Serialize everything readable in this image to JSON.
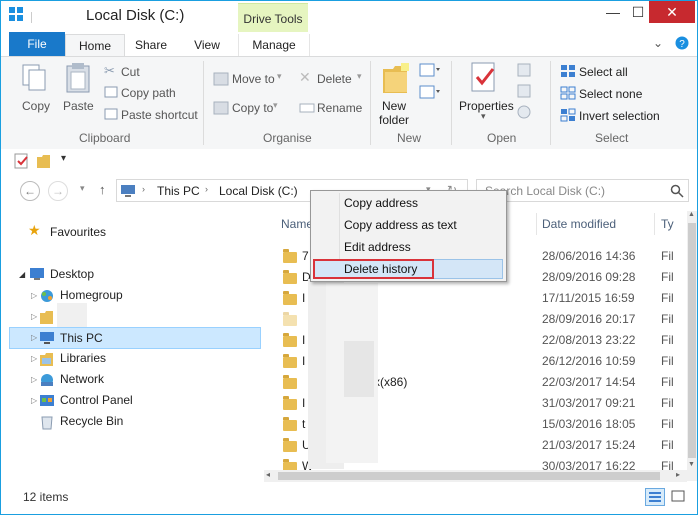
{
  "window": {
    "title": "Local Disk (C:)",
    "context_tab": "Drive Tools",
    "minimize_glyph": "—",
    "maximize_glyph": "☐",
    "close_glyph": "✕"
  },
  "tabs": [
    "File",
    "Home",
    "Share",
    "View",
    "Manage"
  ],
  "ribbon": {
    "clipboard": {
      "copy": "Copy",
      "paste": "Paste",
      "cut": "Cut",
      "copy_path": "Copy path",
      "paste_shortcut": "Paste shortcut",
      "label": "Clipboard"
    },
    "organise": {
      "move_to": "Move to",
      "copy_to": "Copy to",
      "delete": "Delete",
      "rename": "Rename",
      "label": "Organise"
    },
    "new": {
      "new_folder_line1": "New",
      "new_folder_line2": "folder",
      "label": "New"
    },
    "open": {
      "properties": "Properties",
      "label": "Open"
    },
    "select": {
      "select_all": "Select all",
      "select_none": "Select none",
      "invert_selection": "Invert selection",
      "label": "Select"
    }
  },
  "address": {
    "crumbs": [
      "This PC",
      "Local Disk (C:)"
    ],
    "search_placeholder": "Search Local Disk (C:)"
  },
  "nav_pane": {
    "favourites": "Favourites",
    "desktop": "Desktop",
    "homegroup": "Homegroup",
    "this_pc": "This PC",
    "libraries": "Libraries",
    "network": "Network",
    "control_panel": "Control Panel",
    "recycle_bin": "Recycle Bin"
  },
  "columns": {
    "name": "Name",
    "date_modified": "Date modified",
    "type": "Ty"
  },
  "files": [
    {
      "name": "7",
      "date": "28/06/2016 14:36",
      "type": "Fil"
    },
    {
      "name": "D",
      "date": "28/09/2016 09:28",
      "type": "Fil"
    },
    {
      "name": "I",
      "date": "17/11/2015 16:59",
      "type": "Fil"
    },
    {
      "name": "",
      "date": "28/09/2016 20:17",
      "type": "Fil"
    },
    {
      "name": "I",
      "date": "22/08/2013 23:22",
      "type": "Fil"
    },
    {
      "name": "I",
      "date": "26/12/2016 10:59",
      "type": "Fil"
    },
    {
      "name": "x(x86)",
      "date": "22/03/2017 14:54",
      "type": "Fil"
    },
    {
      "name": "I",
      "date": "31/03/2017 09:21",
      "type": "Fil"
    },
    {
      "name": "t",
      "date": "15/03/2016 18:05",
      "type": "Fil"
    },
    {
      "name": "U",
      "date": "21/03/2017 15:24",
      "type": "Fil"
    },
    {
      "name": "W",
      "date": "30/03/2017 16:22",
      "type": "Fil"
    }
  ],
  "status": {
    "items": "12 items"
  },
  "context_menu": {
    "copy_address": "Copy address",
    "copy_address_as_text": "Copy address as text",
    "edit_address": "Edit address",
    "delete_history": "Delete history"
  },
  "colors": {
    "file_tab": "#1979ca",
    "drive_tools": "#e6f5c0",
    "selection": "#cce8ff",
    "highlight_border": "#d9333a",
    "close_button": "#c7292f"
  }
}
